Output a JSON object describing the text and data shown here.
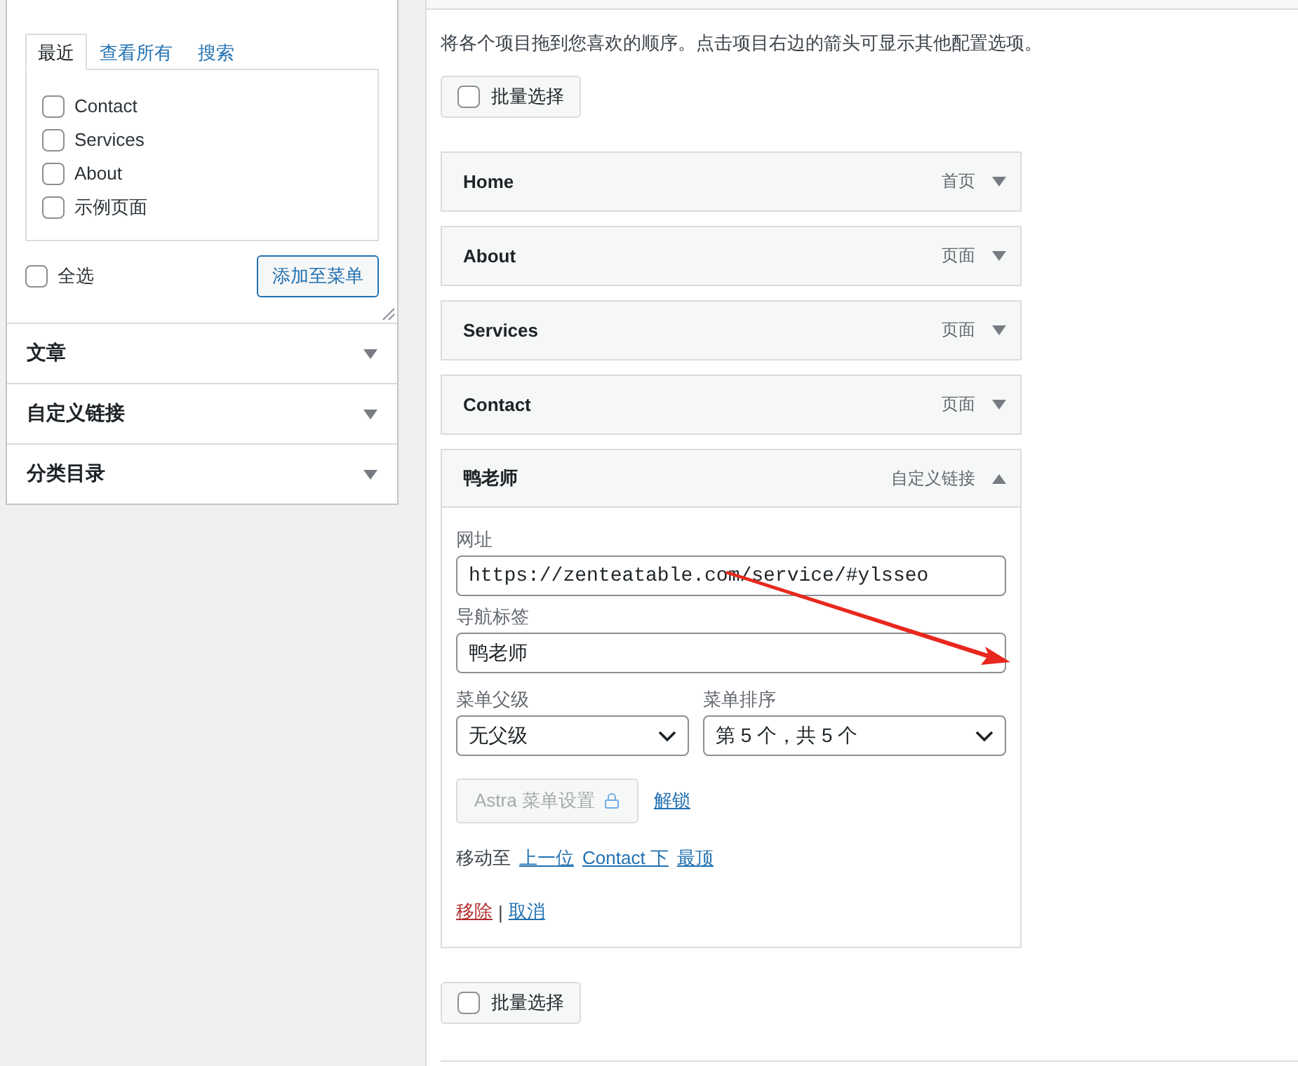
{
  "left_panel": {
    "tabs": [
      {
        "label": "最近",
        "selected": true
      },
      {
        "label": "查看所有",
        "selected": false
      },
      {
        "label": "搜索",
        "selected": false
      }
    ],
    "items": [
      {
        "label": "Contact",
        "checked": false
      },
      {
        "label": "Services",
        "checked": false
      },
      {
        "label": "About",
        "checked": false
      },
      {
        "label": "示例页面",
        "checked": false
      }
    ],
    "select_all": {
      "label": "全选",
      "checked": false
    },
    "add_button": "添加至菜单",
    "sections": [
      {
        "title": "文章",
        "expanded": false
      },
      {
        "title": "自定义链接",
        "expanded": false
      },
      {
        "title": "分类目录",
        "expanded": false
      }
    ]
  },
  "instructions": "将各个项目拖到您喜欢的顺序。点击项目右边的箭头可显示其他配置选项。",
  "bulk_select_top": {
    "label": "批量选择",
    "checked": false
  },
  "menu_items": [
    {
      "title": "Home",
      "type": "首页",
      "expanded": false
    },
    {
      "title": "About",
      "type": "页面",
      "expanded": false
    },
    {
      "title": "Services",
      "type": "页面",
      "expanded": false
    },
    {
      "title": "Contact",
      "type": "页面",
      "expanded": false
    },
    {
      "title": "鸭老师",
      "type": "自定义链接",
      "expanded": true,
      "settings": {
        "url_label": "网址",
        "url": "https://zenteatable.com/service/#ylsseo",
        "nav_label_label": "导航标签",
        "nav_label": "鸭老师",
        "parent_label": "菜单父级",
        "parent_value": "无父级",
        "order_label": "菜单排序",
        "order_value": "第 5 个，共 5 个",
        "astra_button": "Astra 菜单设置",
        "unlock_link": "解锁",
        "move_label": "移动至",
        "move_links": [
          "上一位",
          "Contact 下",
          "最顶"
        ],
        "remove_link": "移除",
        "separator": "|",
        "cancel_link": "取消"
      }
    }
  ],
  "bulk_select_bottom": {
    "label": "批量选择",
    "checked": false
  }
}
